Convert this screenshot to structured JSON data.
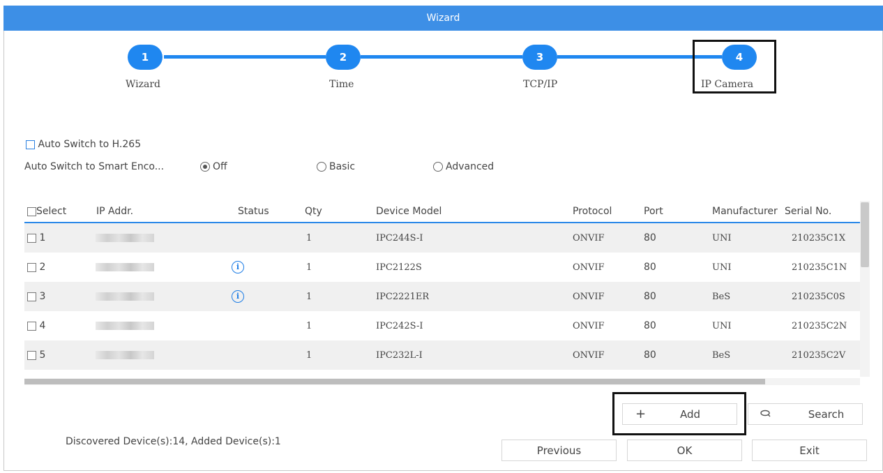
{
  "window": {
    "title": "Wizard"
  },
  "steps": [
    {
      "number": "1",
      "label": "Wizard"
    },
    {
      "number": "2",
      "label": "Time"
    },
    {
      "number": "3",
      "label": "TCP/IP"
    },
    {
      "number": "4",
      "label": "IP Camera"
    }
  ],
  "options": {
    "auto_h265_label": "Auto Switch to H.265",
    "smart_label": "Auto Switch to Smart Enco...",
    "radio_off": "Off",
    "radio_basic": "Basic",
    "radio_advanced": "Advanced",
    "selected_radio": "Off"
  },
  "table": {
    "headers": [
      "Select",
      "IP Addr.",
      "Status",
      "Qty",
      "Device Model",
      "Protocol",
      "Port",
      "Manufacturer",
      "Serial No."
    ],
    "rows": [
      {
        "index": "1",
        "status": "",
        "qty": "1",
        "model": "IPC244S-I",
        "protocol": "ONVIF",
        "port": "80",
        "manufacturer": "UNI",
        "serial": "210235C1X"
      },
      {
        "index": "2",
        "status": "info",
        "qty": "1",
        "model": "IPC2122S",
        "protocol": "ONVIF",
        "port": "80",
        "manufacturer": "UNI",
        "serial": "210235C1N"
      },
      {
        "index": "3",
        "status": "info",
        "qty": "1",
        "model": "IPC2221ER",
        "protocol": "ONVIF",
        "port": "80",
        "manufacturer": "BeS",
        "serial": "210235C0S"
      },
      {
        "index": "4",
        "status": "",
        "qty": "1",
        "model": "IPC242S-I",
        "protocol": "ONVIF",
        "port": "80",
        "manufacturer": "UNI",
        "serial": "210235C2N"
      },
      {
        "index": "5",
        "status": "",
        "qty": "1",
        "model": "IPC232L-I",
        "protocol": "ONVIF",
        "port": "80",
        "manufacturer": "BeS",
        "serial": "210235C2V"
      }
    ]
  },
  "footer": {
    "status_text": "Discovered Device(s):14, Added Device(s):1",
    "add_label": "Add",
    "search_label": "Search",
    "previous_label": "Previous",
    "ok_label": "OK",
    "exit_label": "Exit"
  },
  "icons": {
    "add": "plus-icon",
    "search": "search-icon",
    "status_info": "info-icon"
  },
  "colors": {
    "accent": "#1f87f0",
    "titlebar": "#3d8fe6",
    "info": "#1a7be5"
  }
}
